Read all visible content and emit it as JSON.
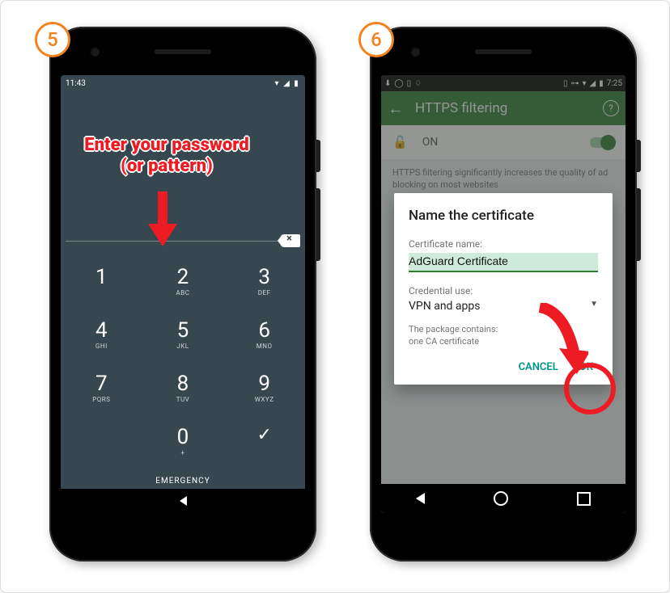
{
  "step5": {
    "badge": "5",
    "statusbar_time": "11:43",
    "keypad": {
      "1": {
        "num": "1",
        "letters": ""
      },
      "2": {
        "num": "2",
        "letters": "ABC"
      },
      "3": {
        "num": "3",
        "letters": "DEF"
      },
      "4": {
        "num": "4",
        "letters": "GHI"
      },
      "5": {
        "num": "5",
        "letters": "JKL"
      },
      "6": {
        "num": "6",
        "letters": "MNO"
      },
      "7": {
        "num": "7",
        "letters": "PQRS"
      },
      "8": {
        "num": "8",
        "letters": "TUV"
      },
      "9": {
        "num": "9",
        "letters": "WXYZ"
      },
      "0": {
        "num": "0",
        "letters": "+"
      }
    },
    "emergency": "EMERGENCY",
    "annotation": "Enter your password (or pattern)"
  },
  "step6": {
    "badge": "6",
    "statusbar_time": "7:25",
    "header": {
      "title": "HTTPS filtering"
    },
    "on_label": "ON",
    "description": "HTTPS filtering significantly increases the quality of ad blocking on most websites",
    "dialog": {
      "title": "Name the certificate",
      "cert_label": "Certificate name:",
      "cert_value": "AdGuard Certificate",
      "cred_label": "Credential use:",
      "cred_value": "VPN and apps",
      "pkg1": "The package contains:",
      "pkg2": "one CA certificate",
      "cancel": "CANCEL",
      "ok": "OK"
    }
  }
}
